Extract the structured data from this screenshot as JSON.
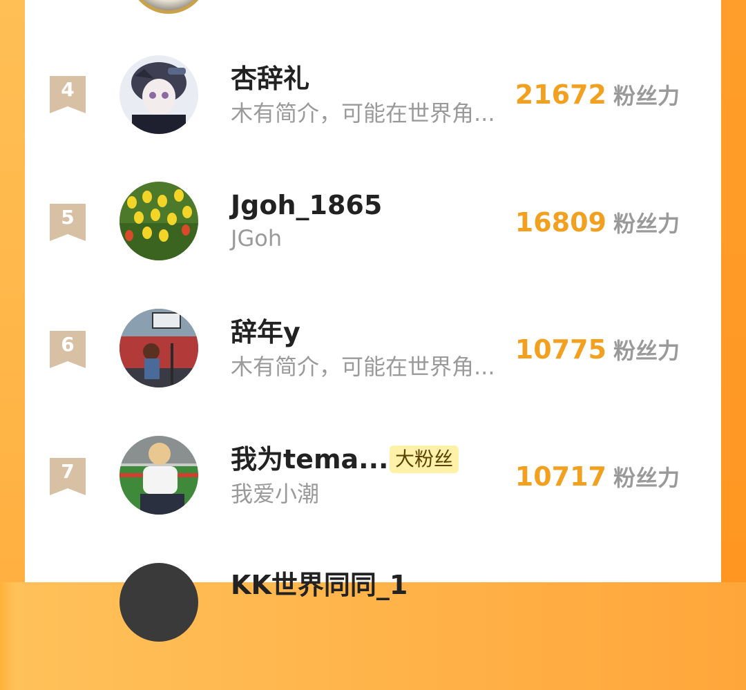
{
  "rows": [
    {
      "rank": "4",
      "name": "杏辞礼",
      "subtitle": "木有简介，可能在世界角...",
      "score": "21672",
      "unit": "粉丝力",
      "avatar": "anime-girl-avatar"
    },
    {
      "rank": "5",
      "name": "Jgoh_1865",
      "subtitle": "JGoh",
      "score": "16809",
      "unit": "粉丝力",
      "avatar": "tulip-field-avatar"
    },
    {
      "rank": "6",
      "name": "辞年y",
      "subtitle": "木有简介，可能在世界角...",
      "score": "10775",
      "unit": "粉丝力",
      "avatar": "anime-bus-stop-avatar"
    },
    {
      "rank": "7",
      "name": "我为tema...",
      "tag": "大粉丝",
      "subtitle": "我爱小潮",
      "score": "10717",
      "unit": "粉丝力",
      "avatar": "boy-photo-avatar"
    },
    {
      "name": "KK世界同同_1"
    }
  ],
  "colors": {
    "accent": "#f2a01f",
    "badge": "#d8c0a4",
    "tag_bg": "#fff1a8",
    "frame": "#ffa63a"
  }
}
